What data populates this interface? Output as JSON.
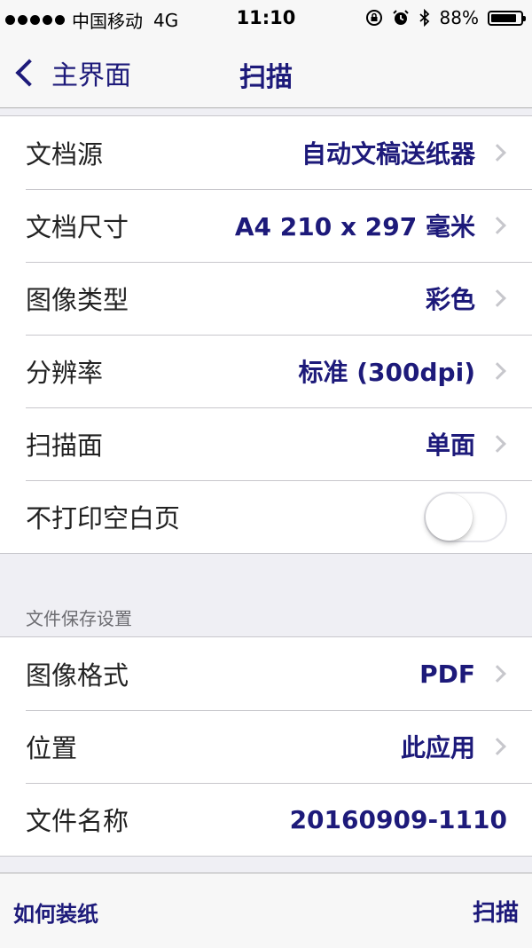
{
  "status_bar": {
    "carrier": "中国移动",
    "network": "4G",
    "time": "11:10",
    "battery": "88%",
    "battery_level": 0.88
  },
  "nav": {
    "back_label": "主界面",
    "title": "扫描"
  },
  "scan_settings": [
    {
      "label": "文档源",
      "value": "自动文稿送纸器"
    },
    {
      "label": "文档尺寸",
      "value": "A4 210 x 297 毫米"
    },
    {
      "label": "图像类型",
      "value": "彩色"
    },
    {
      "label": "分辨率",
      "value": "标准 (300dpi)"
    },
    {
      "label": "扫描面",
      "value": "单面"
    },
    {
      "label": "不打印空白页",
      "toggle": false
    }
  ],
  "file_section": {
    "header": "文件保存设置",
    "rows": [
      {
        "label": "图像格式",
        "value": "PDF"
      },
      {
        "label": "位置",
        "value": "此应用"
      },
      {
        "label": "文件名称",
        "value": "20160909-1110"
      }
    ]
  },
  "toolbar": {
    "left_label": "如何装纸",
    "right_label": "扫描"
  },
  "colors": {
    "accent": "#1d1a7a",
    "background": "#efeff4"
  }
}
